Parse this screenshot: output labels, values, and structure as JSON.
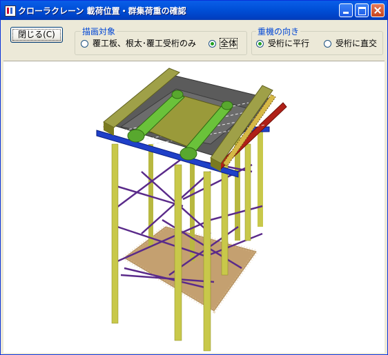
{
  "window": {
    "title": "クローラクレーン 載荷位置・群集荷重の確認"
  },
  "toolbar": {
    "close_label": "閉じる(C)",
    "draw_target": {
      "legend": "描画対象",
      "options": [
        {
          "label": "覆工板、根太･覆工受桁のみ",
          "selected": false
        },
        {
          "label": "全体",
          "selected": true
        }
      ]
    },
    "crane_direction": {
      "legend": "重機の向き",
      "options": [
        {
          "label": "受桁に平行",
          "selected": true
        },
        {
          "label": "受桁に直交",
          "selected": false
        }
      ]
    }
  },
  "colors": {
    "column": "#c8c84a",
    "bracing": "#5a2a8a",
    "beam_blue": "#1f40c8",
    "beam_red": "#b02018",
    "deck": "#9fa048",
    "crane_track": "#6ac23a",
    "ground": "#c4a070"
  }
}
